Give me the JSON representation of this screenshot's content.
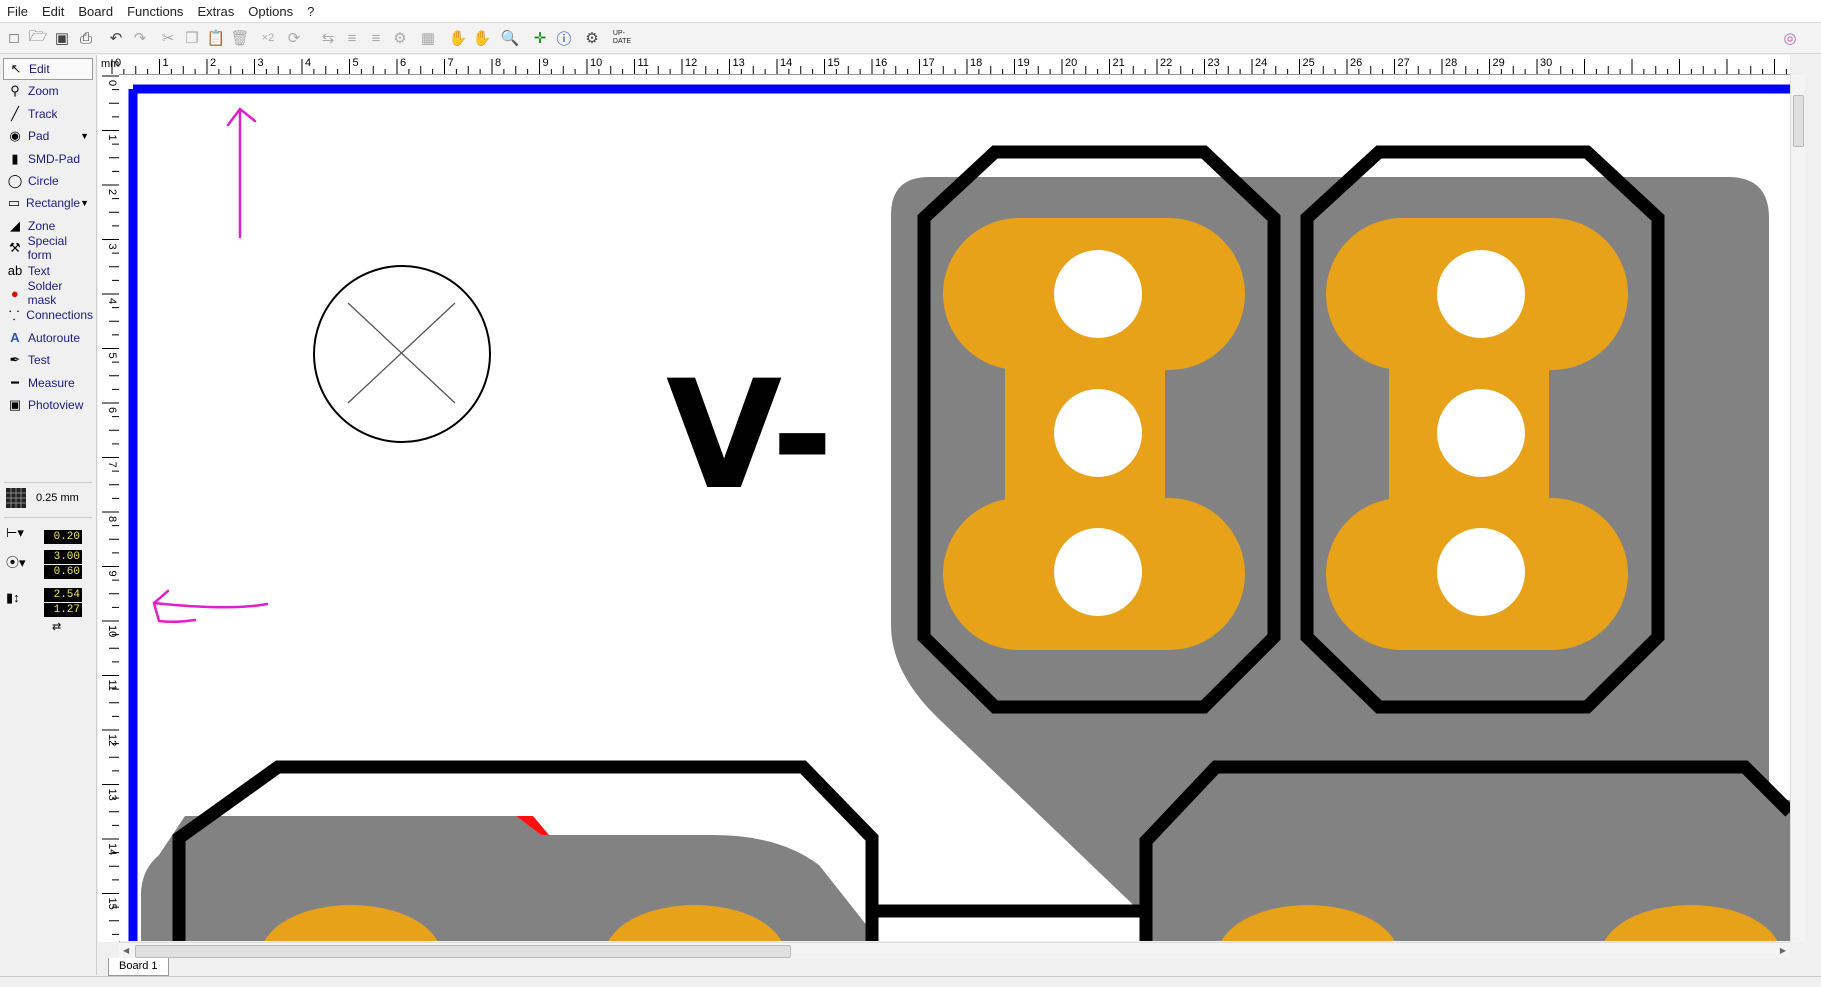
{
  "menu": [
    "File",
    "Edit",
    "Board",
    "Functions",
    "Extras",
    "Options",
    "?"
  ],
  "tools": [
    {
      "label": "Edit",
      "icon": "pointer-icon",
      "active": true
    },
    {
      "label": "Zoom",
      "icon": "magnifier-icon"
    },
    {
      "label": "Track",
      "icon": "track-icon"
    },
    {
      "label": "Pad",
      "icon": "pad-icon",
      "dropdown": true
    },
    {
      "label": "SMD-Pad",
      "icon": "smd-pad-icon"
    },
    {
      "label": "Circle",
      "icon": "circle-icon"
    },
    {
      "label": "Rectangle",
      "icon": "rectangle-icon",
      "dropdown": true
    },
    {
      "label": "Zone",
      "icon": "zone-icon"
    },
    {
      "label": "Special form",
      "icon": "special-form-icon"
    },
    {
      "label": "Text",
      "icon": "text-icon"
    },
    {
      "label": "Solder mask",
      "icon": "solder-mask-icon"
    },
    {
      "label": "Connections",
      "icon": "connections-icon"
    },
    {
      "label": "Autoroute",
      "icon": "autoroute-icon"
    },
    {
      "label": "Test",
      "icon": "test-icon"
    },
    {
      "label": "Measure",
      "icon": "measure-icon"
    },
    {
      "label": "Photoview",
      "icon": "photoview-icon"
    }
  ],
  "grid": {
    "label": "0.25 mm"
  },
  "track_width": "0.20",
  "pad": {
    "outer": "3.00",
    "inner": "0.60"
  },
  "smd": {
    "width": "2.54",
    "height": "1.27"
  },
  "ruler": {
    "unit": "mm",
    "top_labels": [
      "0",
      "1",
      "2",
      "3",
      "4",
      "5",
      "6",
      "7",
      "8",
      "9",
      "10",
      "11",
      "12",
      "13",
      "14",
      "15",
      "16",
      "17",
      "18",
      "19",
      "20",
      "21",
      "22",
      "23",
      "24",
      "25",
      "26",
      "27",
      "28",
      "29",
      "30"
    ],
    "left_labels": [
      "0",
      "1",
      "2",
      "3",
      "4",
      "5",
      "6",
      "7",
      "8",
      "9",
      "10",
      "11",
      "12",
      "13",
      "14",
      "15"
    ]
  },
  "board_text": "V-",
  "tab_label": "Board 1",
  "toolbar_badge": "UP-\nDATE",
  "colors": {
    "copper": "#e8a21a",
    "ground": "#828282",
    "outline": "#0000ff",
    "annotation": "#e020c8",
    "silk": "#000000"
  }
}
